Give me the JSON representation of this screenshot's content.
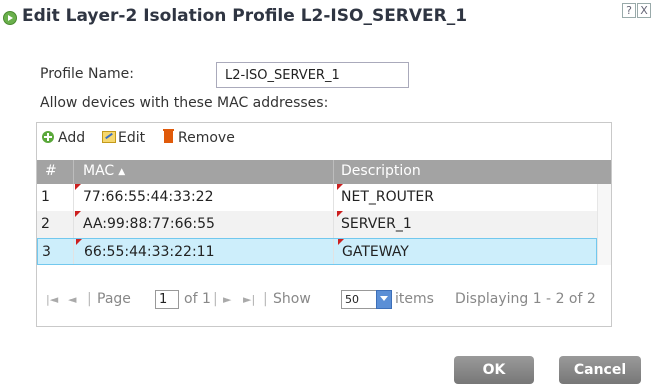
{
  "dialog": {
    "title": "Edit Layer-2 Isolation Profile L2-ISO_SERVER_1",
    "help_label": "?",
    "close_label": "X"
  },
  "form": {
    "profile_name_label": "Profile Name:",
    "profile_name_value": "L2-ISO_SERVER_1",
    "allow_label": "Allow devices with these MAC addresses:"
  },
  "toolbar": {
    "add_label": "Add",
    "edit_label": "Edit",
    "remove_label": "Remove"
  },
  "table": {
    "columns": {
      "num": "#",
      "mac": "MAC",
      "description": "Description"
    },
    "sort_indicator": "▲",
    "rows": [
      {
        "num": "1",
        "mac": "77:66:55:44:33:22",
        "description": "NET_ROUTER"
      },
      {
        "num": "2",
        "mac": "AA:99:88:77:66:55",
        "description": "SERVER_1"
      },
      {
        "num": "3",
        "mac": "66:55:44:33:22:11",
        "description": "GATEWAY"
      }
    ],
    "selected_row": 3
  },
  "pager": {
    "first_icon": "|◄",
    "prev_icon": "◄",
    "page_label": "Page",
    "page_value": "1",
    "of_label": "of 1",
    "next_icon": "►",
    "last_icon": "►|",
    "show_label": "Show",
    "show_value": "50",
    "items_label": "items",
    "displaying": "Displaying 1 - 2 of 2"
  },
  "buttons": {
    "ok": "OK",
    "cancel": "Cancel"
  },
  "colors": {
    "header_bg": "#a3a3a3",
    "selected_row_bg": "#cdeefb",
    "button_bg": "#888888",
    "accent_icon": "#5aa83a"
  }
}
